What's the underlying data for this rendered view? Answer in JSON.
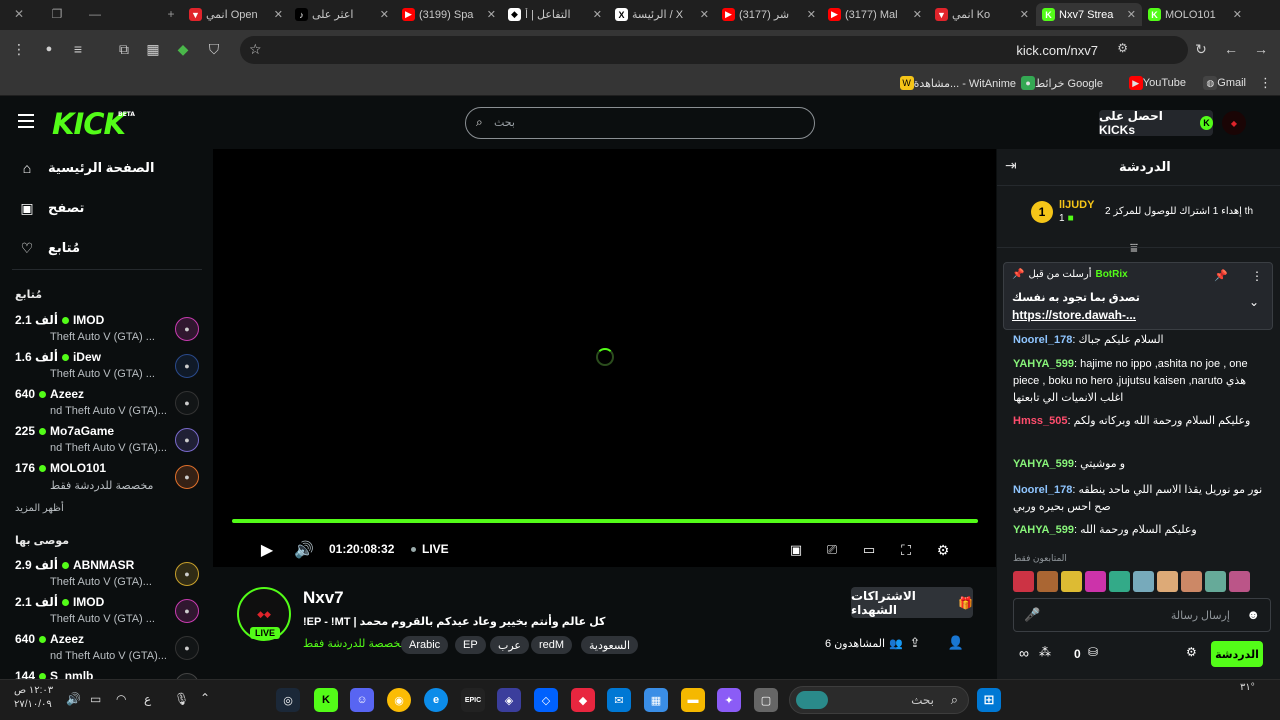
{
  "browser": {
    "tabs": [
      {
        "title": "انمي Open",
        "color": "#e0242b",
        "glyph": "▼"
      },
      {
        "title": "اعثر على",
        "color": "#000000",
        "glyph": "♪"
      },
      {
        "title": "(3199) Spa",
        "color": "#ff0000",
        "glyph": "▶"
      },
      {
        "title": "التفاعل | أ",
        "color": "#ffffff",
        "glyph": "◆"
      },
      {
        "title": "الرئيسة / X",
        "color": "#ffffff",
        "glyph": "X"
      },
      {
        "title": "(3177) شر",
        "color": "#ff0000",
        "glyph": "▶"
      },
      {
        "title": "(3177) Mal",
        "color": "#ff0000",
        "glyph": "▶"
      },
      {
        "title": "انمي Ko",
        "color": "#e0242b",
        "glyph": "▼"
      },
      {
        "title": "Nxv7 Strea",
        "color": "#53fc18",
        "glyph": "K"
      },
      {
        "title": "MOLO101",
        "color": "#53fc18",
        "glyph": "K"
      }
    ],
    "url": "kick.com/nxv7",
    "bookmarks": [
      {
        "label": "Gmail",
        "color": "#ffffff"
      },
      {
        "label": "YouTube",
        "color": "#ff0000"
      },
      {
        "label": "خرائط Google",
        "color": "#34a853"
      },
      {
        "label": "مشاهدة... - WitAnime",
        "color": "#f5c518"
      }
    ]
  },
  "header": {
    "logo": "KICK",
    "logo_badge": "BETA",
    "search_placeholder": "بحث",
    "get_kicks": "احصل على KICKs"
  },
  "sidebar": {
    "nav": [
      {
        "label": "الصفحة الرئيسية",
        "icon": "⌂"
      },
      {
        "label": "تصفح",
        "icon": "▣"
      },
      {
        "label": "مُتابع",
        "icon": "♡"
      }
    ],
    "following_title": "مُتابع",
    "following": [
      {
        "viewers": "2.1 ألف",
        "name": "IMOD",
        "game": "Theft Auto V (GTA) ...",
        "av": "#c83bb0"
      },
      {
        "viewers": "1.6 ألف",
        "name": "iDew",
        "game": "Theft Auto V (GTA) ...",
        "av": "#2a4a8c"
      },
      {
        "viewers": "640",
        "name": "Azeez",
        "game": "nd Theft Auto V (GTA)...",
        "av": "#333333"
      },
      {
        "viewers": "225",
        "name": "Mo7aGame",
        "game": "nd Theft Auto V (GTA)...",
        "av": "#7a6acc"
      },
      {
        "viewers": "176",
        "name": "MOLO101",
        "game": "مخصصة للدردشة فقط",
        "av": "#e0702b"
      }
    ],
    "show_more": "أظهر المزيد",
    "recommended_title": "موصى بها",
    "recommended": [
      {
        "viewers": "2.9 ألف",
        "name": "ABNMASR",
        "game": "Theft Auto V (GTA)...",
        "av": "#c8a02b"
      },
      {
        "viewers": "2.1 ألف",
        "name": "IMOD",
        "game": "Theft Auto V (GTA) ...",
        "av": "#c83bb0"
      },
      {
        "viewers": "640",
        "name": "Azeez",
        "game": "nd Theft Auto V (GTA)...",
        "av": "#333333"
      },
      {
        "viewers": "144",
        "name": "S_nmlb",
        "game": "",
        "av": "#444444"
      }
    ]
  },
  "player": {
    "time": "01:20:08:32",
    "live": "LIVE",
    "progress": 1.0
  },
  "stream": {
    "name": "Nxv7",
    "title": "!EP - !MT | كل عالم وأنتم بخيير وعاد عيدكم بالقروم محمد",
    "category": "مخصصة للدردشة فقط",
    "tags": [
      "السعودية",
      "redM",
      "عرب",
      "EP",
      "Arabic"
    ],
    "subscribe": "الاشتراكات الشهداء",
    "viewers": "6 المشاهدون",
    "live_badge": "LIVE"
  },
  "chat": {
    "title": "الدردشة",
    "leader": {
      "name": "llJUDY",
      "count": "1",
      "rank": "1",
      "goal": "إهداء 1 اشتراك للوصول للمركز 2 th"
    },
    "pinned": {
      "by": "أرسلت من قبل",
      "user": "BotRix",
      "text": "تصدق بما تجود به نفسك",
      "link": "https://store.dawah-..."
    },
    "messages": [
      {
        "user": "Noorel_178",
        "color": "#8fc5ff",
        "text": "السلام عليكم جباك"
      },
      {
        "user": "YAHYA_599",
        "color": "#88f57a",
        "text": "hajime no ippo ,ashita no joe , one piece , boku no hero ,jujutsu kaisen ,naruto هذي اغلب الانميات الي تابعتها"
      },
      {
        "user": "Hmss_505",
        "color": "#ff4d6d",
        "text": "وعليكم السلام ورحمة الله وبركاته ولكم"
      },
      {
        "user": "YAHYA_599",
        "color": "#88f57a",
        "text": "و موشيتي"
      },
      {
        "user": "Noorel_178",
        "color": "#8fc5ff",
        "text": "نور مو نوريل يقذا الاسم اللي ماحد ينطقه صح احس بحيره وربي"
      },
      {
        "user": "YAHYA_599",
        "color": "#88f57a",
        "text": "وعليكم السلام ورحمة الله"
      }
    ],
    "subs_only": "المتابعون فقط",
    "input_placeholder": "إرسال رسالة",
    "points": "0",
    "send": "الدردشة"
  },
  "taskbar": {
    "search": "بحث",
    "time": "١٢:٠٣ ص",
    "date": "٢٧/١٠/٠٩",
    "lang": "ع",
    "temp": "٣١°"
  }
}
